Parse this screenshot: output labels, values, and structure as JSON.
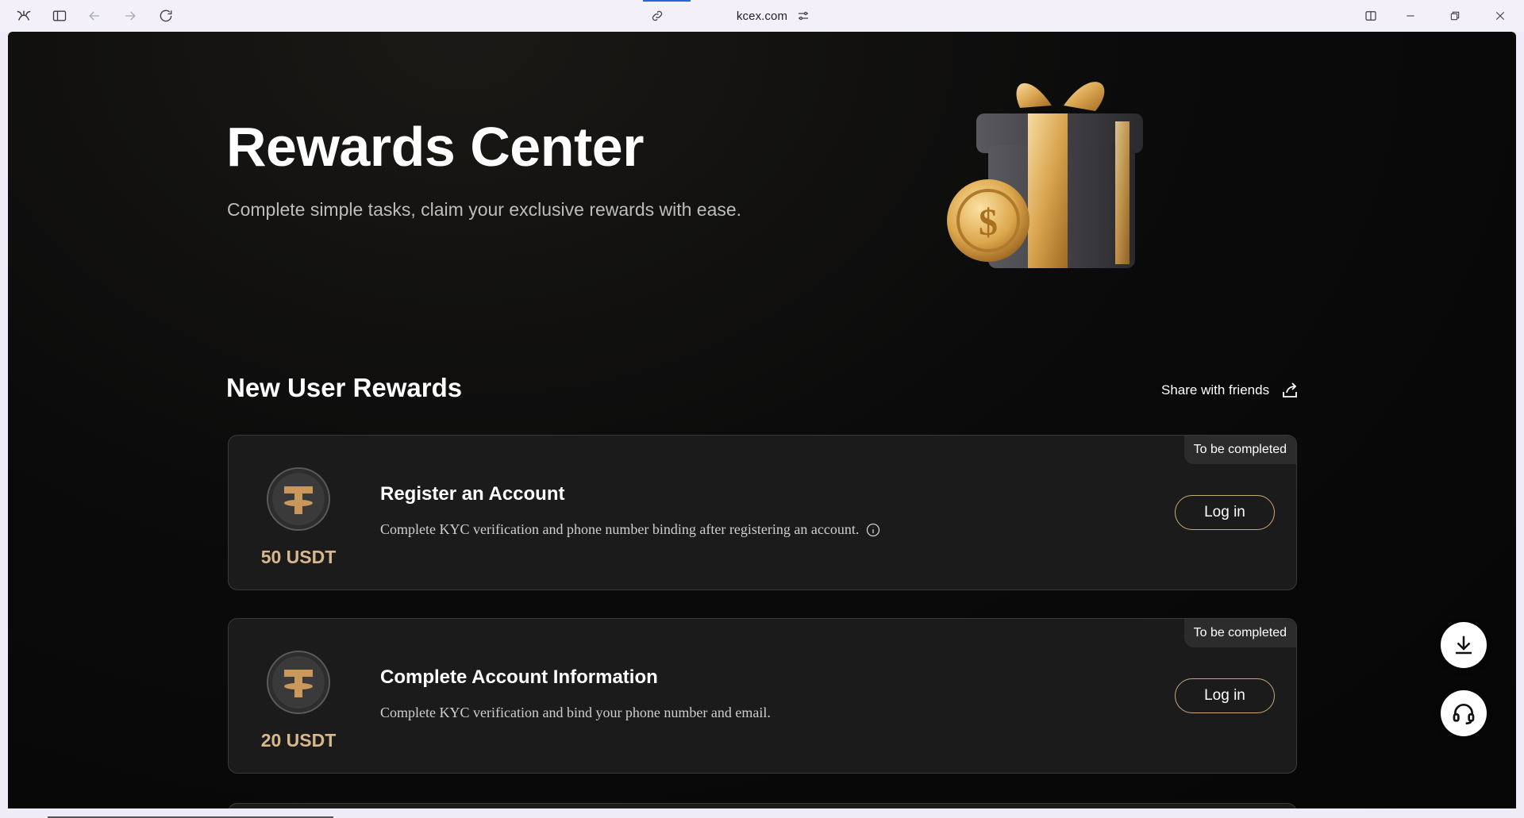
{
  "browser": {
    "url": "kcex.com"
  },
  "hero": {
    "title": "Rewards Center",
    "subtitle": "Complete simple tasks, claim your exclusive rewards with ease."
  },
  "section": {
    "title": "New User Rewards",
    "share_label": "Share with friends"
  },
  "tasks": [
    {
      "status": "To be completed",
      "reward": "50 USDT",
      "title": "Register an Account",
      "description": "Complete KYC verification and phone number binding after registering an account.",
      "has_info": true,
      "button": "Log in"
    },
    {
      "status": "To be completed",
      "reward": "20 USDT",
      "title": "Complete Account Information",
      "description": "Complete KYC verification and bind your phone number and email.",
      "has_info": false,
      "button": "Log in"
    }
  ],
  "colors": {
    "accent_gold": "#c8a978",
    "reward_text": "#d8b88a",
    "card_bg": "#1b1b1b",
    "page_bg": "#0b0b0b"
  },
  "icons": {
    "download": "download-icon",
    "support": "headset-icon",
    "share": "share-icon"
  }
}
